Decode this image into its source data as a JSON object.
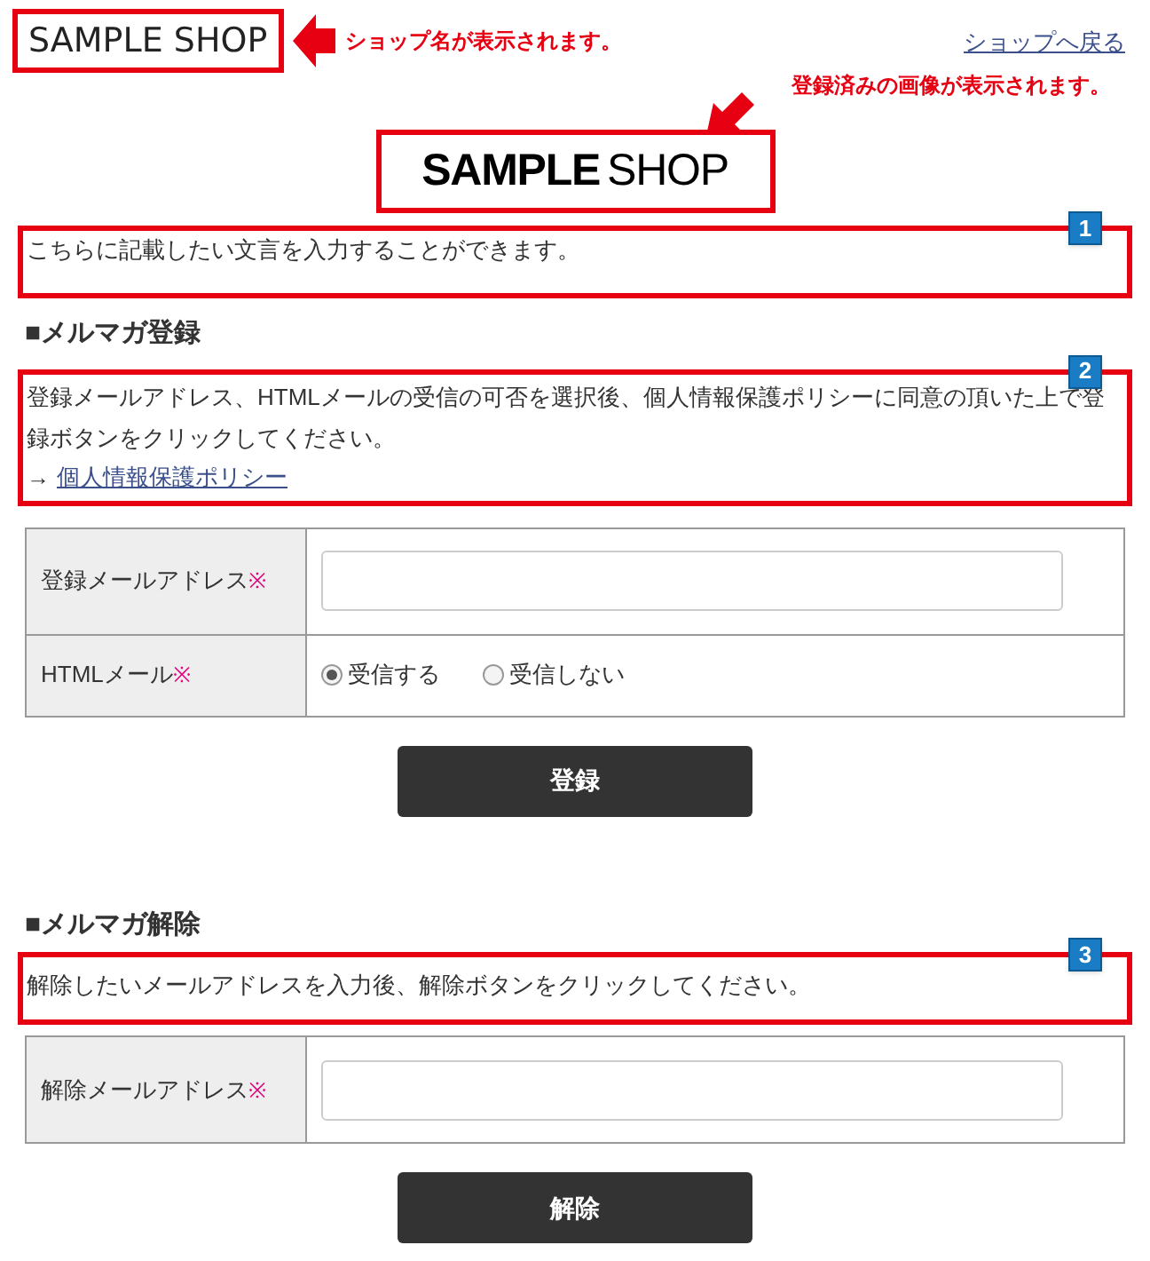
{
  "header": {
    "shop_name": "SAMPLE SHOP",
    "back_link": "ショップへ戻る"
  },
  "annotations": [
    {
      "text": "ショップ名が表示されます。"
    },
    {
      "text": "登録済みの画像が表示されます。"
    }
  ],
  "logo": {
    "bold": "SAMPLE",
    "light": "SHOP"
  },
  "intro": {
    "badge": "1",
    "text": "こちらに記載したい文言を入力することができます。"
  },
  "subscribe": {
    "heading": "■メルマガ登録",
    "badge": "2",
    "description": "登録メールアドレス、HTMLメールの受信の可否を選択後、個人情報保護ポリシーに同意の頂いた上で登録ボタンをクリックしてください。",
    "policy_arrow": "→",
    "policy_link": "個人情報保護ポリシー",
    "fields": [
      {
        "kind": "text",
        "label": "登録メールアドレス",
        "required_mark": "※"
      },
      {
        "kind": "radio",
        "label": "HTMLメール",
        "required_mark": "※",
        "options": [
          {
            "label": "受信する",
            "selected": true
          },
          {
            "label": "受信しない",
            "selected": false
          }
        ]
      }
    ],
    "button": "登録"
  },
  "unsubscribe": {
    "heading": "■メルマガ解除",
    "badge": "3",
    "description": "解除したいメールアドレスを入力後、解除ボタンをクリックしてください。",
    "fields": [
      {
        "kind": "text",
        "label": "解除メールアドレス",
        "required_mark": "※"
      }
    ],
    "button": "解除"
  }
}
